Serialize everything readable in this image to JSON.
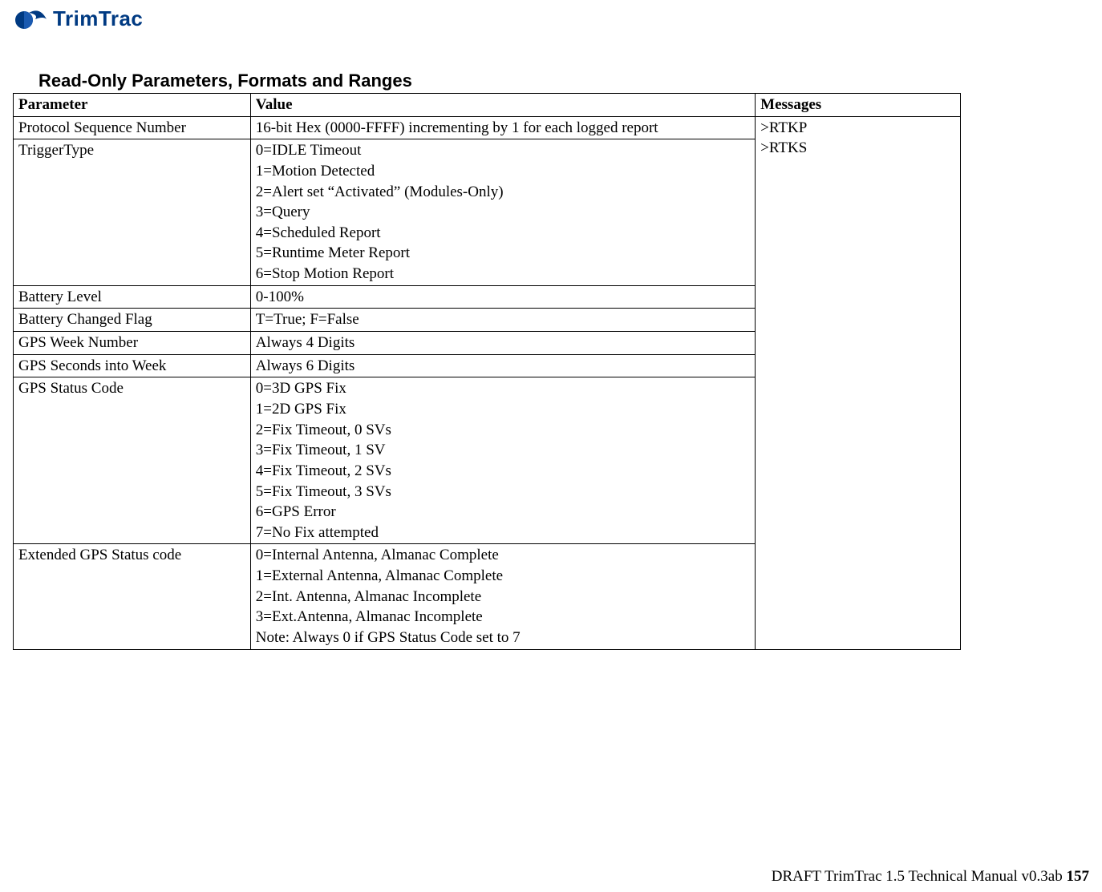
{
  "logo": {
    "text": "TrimTrac"
  },
  "section_title": "Read-Only Parameters, Formats and Ranges",
  "headers": {
    "parameter": "Parameter",
    "value": "Value",
    "messages": "Messages"
  },
  "messages_cell": ">RTKP\n>RTKS",
  "rows": [
    {
      "param": "Protocol Sequence Number",
      "value": "16-bit Hex (0000-FFFF) incrementing by 1 for each logged report"
    },
    {
      "param": "TriggerType",
      "value": "0=IDLE Timeout\n1=Motion Detected\n2=Alert set “Activated” (Modules-Only)\n3=Query\n4=Scheduled Report\n5=Runtime Meter Report\n6=Stop Motion Report"
    },
    {
      "param": "Battery Level",
      "value": "0-100%"
    },
    {
      "param": "Battery Changed Flag",
      "value": "T=True; F=False"
    },
    {
      "param": "GPS Week Number",
      "value": "Always 4 Digits"
    },
    {
      "param": "GPS Seconds into Week",
      "value": "Always 6 Digits"
    },
    {
      "param": "GPS Status Code",
      "value": "0=3D GPS Fix\n1=2D GPS Fix\n2=Fix Timeout, 0 SVs\n3=Fix Timeout, 1 SV\n4=Fix Timeout, 2 SVs\n5=Fix Timeout, 3 SVs\n6=GPS Error\n7=No Fix attempted"
    },
    {
      "param": "Extended GPS Status code",
      "value": "0=Internal Antenna, Almanac Complete\n1=External Antenna, Almanac Complete\n2=Int. Antenna, Almanac Incomplete\n3=Ext.Antenna, Almanac Incomplete\nNote: Always 0 if GPS Status Code set to 7"
    }
  ],
  "footer": {
    "text": "DRAFT TrimTrac 1.5 Technical Manual v0.3ab ",
    "page": "157"
  }
}
